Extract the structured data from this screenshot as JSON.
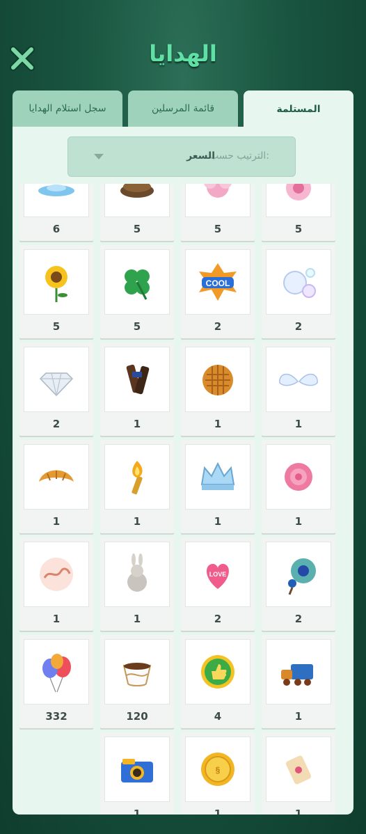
{
  "header": {
    "title": "الهدايا"
  },
  "tabs": [
    {
      "label": "المستلمة"
    },
    {
      "label": "قائمة المرسلين"
    },
    {
      "label": "سجل استلام الهدايا"
    }
  ],
  "sort": {
    "label": "الترتيب حسب:",
    "value": "السعر"
  },
  "gifts": [
    {
      "icon": "pink-flower-icon",
      "count": "5"
    },
    {
      "icon": "pink-bloom-icon",
      "count": "5"
    },
    {
      "icon": "chocolate-cake-icon",
      "count": "5"
    },
    {
      "icon": "water-splash-icon",
      "count": "6"
    },
    {
      "icon": "bubbles-icon",
      "count": "2"
    },
    {
      "icon": "cool-badge-icon",
      "count": "2"
    },
    {
      "icon": "four-leaf-clover-icon",
      "count": "5"
    },
    {
      "icon": "sunflower-icon",
      "count": "5"
    },
    {
      "icon": "angel-wings-icon",
      "count": "1"
    },
    {
      "icon": "waffle-icon",
      "count": "1"
    },
    {
      "icon": "chocolate-bar-icon",
      "count": "1"
    },
    {
      "icon": "diamond-icon",
      "count": "2"
    },
    {
      "icon": "rose-icon",
      "count": "1"
    },
    {
      "icon": "crown-icon",
      "count": "1"
    },
    {
      "icon": "torch-icon",
      "count": "1"
    },
    {
      "icon": "croissant-icon",
      "count": "1"
    },
    {
      "icon": "peacock-icon",
      "count": "2"
    },
    {
      "icon": "love-balloon-icon",
      "count": "2"
    },
    {
      "icon": "rabbit-icon",
      "count": "1"
    },
    {
      "icon": "arabic-calligraphy-icon",
      "count": "1"
    },
    {
      "icon": "train-icon",
      "count": "1"
    },
    {
      "icon": "thumbs-up-icon",
      "count": "4"
    },
    {
      "icon": "arabic-coffee-cup-icon",
      "count": "120"
    },
    {
      "icon": "balloons-icon",
      "count": "332"
    },
    {
      "icon": "scroll-icon",
      "count": "1"
    },
    {
      "icon": "gold-coin-icon",
      "count": "1"
    },
    {
      "icon": "camera-icon",
      "count": "1"
    }
  ]
}
